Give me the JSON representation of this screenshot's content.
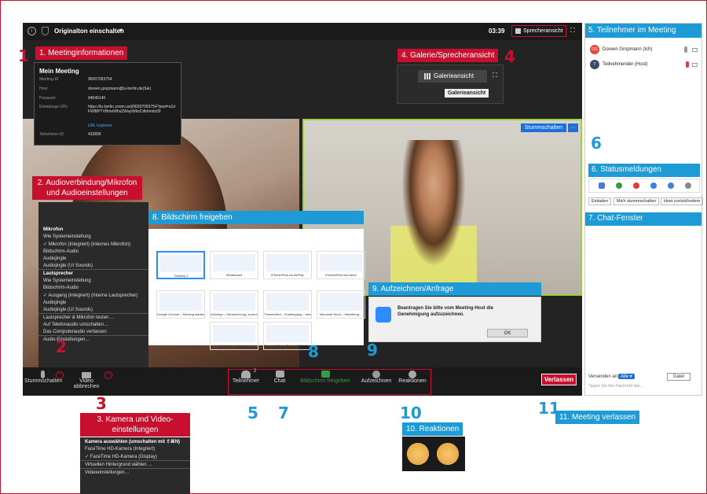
{
  "zoom": {
    "top": {
      "original_sound": "Originalton einschalten",
      "timer": "03:39",
      "speaker_view": "Sprecheransicht"
    },
    "meeting_info": {
      "title": "Mein Meeting",
      "rows": [
        {
          "k": "Meeting-ID",
          "v": "96007083754"
        },
        {
          "k": "Host",
          "v": "doreen.gropmann@tu-berlin.de(Sie)"
        },
        {
          "k": "Passwort",
          "v": "94646140"
        },
        {
          "k": "Einladungs-URL",
          "v": "https://tu-berlin.zoom.us/j/96007083754?pwd=a1dFWlBPTVBmeWhsZWwyWkxCdkhmdz09"
        },
        {
          "k": "Teilnehmer-ID",
          "v": "433896"
        }
      ],
      "copy": "URL kopieren"
    },
    "gallery_btn": "Galerieansicht",
    "gallery_tooltip": "Galerieansicht",
    "mute_tag": "Stummschalten",
    "audio_menu": {
      "mic_header": "Mikrofon",
      "mic_items": [
        "Wie Systemeinstellung",
        "Mikrofon (Integriert) (Internes Mikrofon)",
        "Bildschirm-Audio",
        "Audiojingle",
        "Audiojingle (UI Sounds)"
      ],
      "spk_header": "Lautsprecher",
      "spk_items": [
        "Wie Systemeinstellung",
        "Bildschirm-Audio",
        "Ausgang (Integriert) (Interne Lautsprecher)",
        "Audiojingle",
        "Audiojingle (UI Sounds)"
      ],
      "extra": [
        "Lautsprecher & Mikrofon testen…",
        "Auf Telefonaudio umschalten…",
        "Das Computeraudio verlassen"
      ],
      "settings": "Audio-Einstellungen…"
    },
    "share": {
      "tiles": [
        "Desktop 1",
        "Whiteboard",
        "iPhone/iPad via AirPlay",
        "iPhone/iPad via Kabel",
        "Google Chrome – Meeting starten…",
        "InDesign – Handreichung_zoom.in…",
        "Thunderbird – Posteingang – done…",
        "Microsoft Word – Sitzleitung…",
        "Kalender – Kalender",
        "Microsoft PowerPoint – 2004 Zoo…"
      ]
    },
    "record_dialog": {
      "text": "Beantragen Sie bitte vom Meeting-Host die Genehmigung aufzuzeichnen.",
      "ok": "OK"
    },
    "toolbar": {
      "mute": "Stummschalten",
      "video": "Video abbrechen",
      "participants": "Teilnehmer",
      "participants_count": "2",
      "chat": "Chat",
      "share": "Bildschirm freigeben",
      "record": "Aufzeichnen",
      "reactions": "Reaktionen",
      "leave": "Verlassen"
    },
    "video_menu": {
      "header": "Kamera auswählen (umschalten mit ⇧⌘N)",
      "items": [
        "FaceTime HD-Kamera (Integriert)",
        "FaceTime HD-Kamera (Display)"
      ],
      "virtual": "Virtuellen Hintergrund wählen …",
      "settings": "Videoeinstellungen…"
    }
  },
  "sidebar": {
    "participants_title": "5. Teilnehmer im Meeting",
    "participants": [
      {
        "initials": "DG",
        "name": "Doreen Gropmann (Ich)",
        "color": "#e8453c"
      },
      {
        "initials": "T",
        "name": "Teilnehmender (Host)",
        "color": "#3b4a6b"
      }
    ],
    "status_title": "6. Statusmeldungen",
    "status_buttons": [
      "Einladen",
      "Mich stummschalten",
      "Host zurückfordern"
    ],
    "chat_title": "7. Chat-Fenster",
    "send_to": "Versenden an:",
    "all": "Alle",
    "file": "Datei",
    "type_hint": "Tippen Sie Ihre Nachricht hier…"
  },
  "callouts": {
    "c1": "1. Meetinginformationen",
    "c2": "2. Audioverbindung/Mikrofon und Audioeinstellungen",
    "c3": "3. Kamera und Video-einstellungen",
    "c4": "4. Galerie/Sprecheransicht",
    "c8": "8. Bildschirm freigeben",
    "c9": "9. Aufzeichnen/Anfrage",
    "c10": "10. Reaktionen",
    "c11": "11. Meeting verlassen"
  },
  "numbers": {
    "n1": "1",
    "n2": "2",
    "n3": "3",
    "n4": "4",
    "n5": "5",
    "n6": "6",
    "n7": "7",
    "n8": "8",
    "n9": "9",
    "n10": "10",
    "n11": "11"
  },
  "colors": {
    "accent_red": "#c8102e",
    "accent_blue": "#1e9bd7",
    "zoom_green": "#2ea043"
  }
}
